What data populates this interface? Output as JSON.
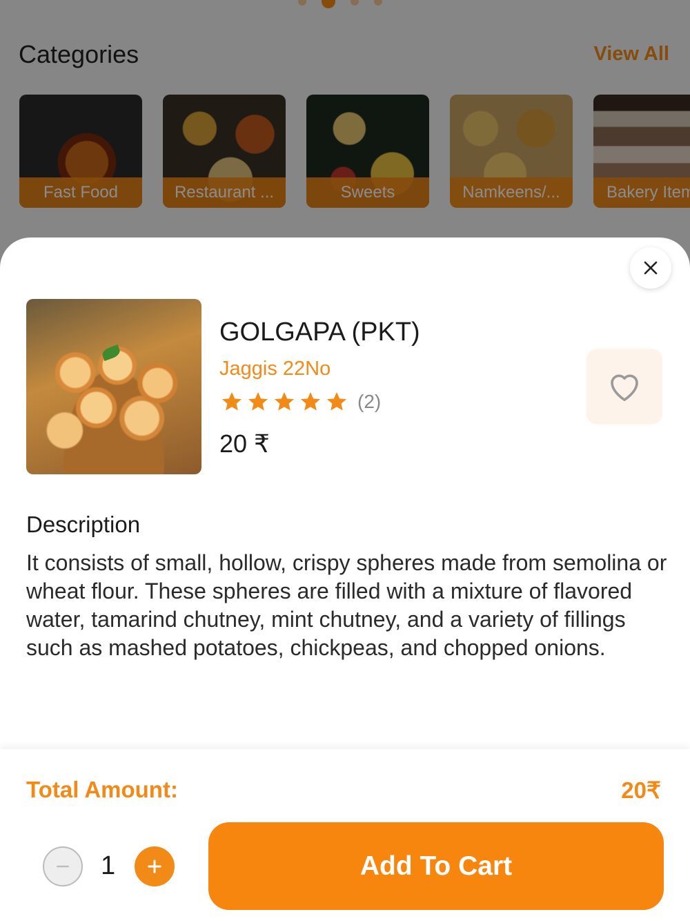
{
  "categories_section": {
    "title": "Categories",
    "view_all_label": "View All",
    "items": [
      {
        "label": "Fast Food"
      },
      {
        "label": "Restaurant ..."
      },
      {
        "label": "Sweets"
      },
      {
        "label": "Namkeens/..."
      },
      {
        "label": "Bakery Items"
      }
    ]
  },
  "product": {
    "name": "GOLGAPA (PKT)",
    "vendor": "Jaggis 22No",
    "rating_stars": 5,
    "rating_count": "(2)",
    "price": "20 ₹",
    "description_title": "Description",
    "description": "It consists of small, hollow, crispy spheres made from semolina or wheat flour. These spheres are filled with a mixture of flavored water, tamarind chutney, mint chutney, and a variety of fillings such as mashed potatoes, chickpeas, and chopped onions."
  },
  "footer": {
    "total_label": "Total Amount:",
    "total_value": "20₹",
    "quantity": "1",
    "add_to_cart_label": "Add To Cart"
  },
  "colors": {
    "accent": "#f28a17",
    "button": "#f7860e"
  }
}
